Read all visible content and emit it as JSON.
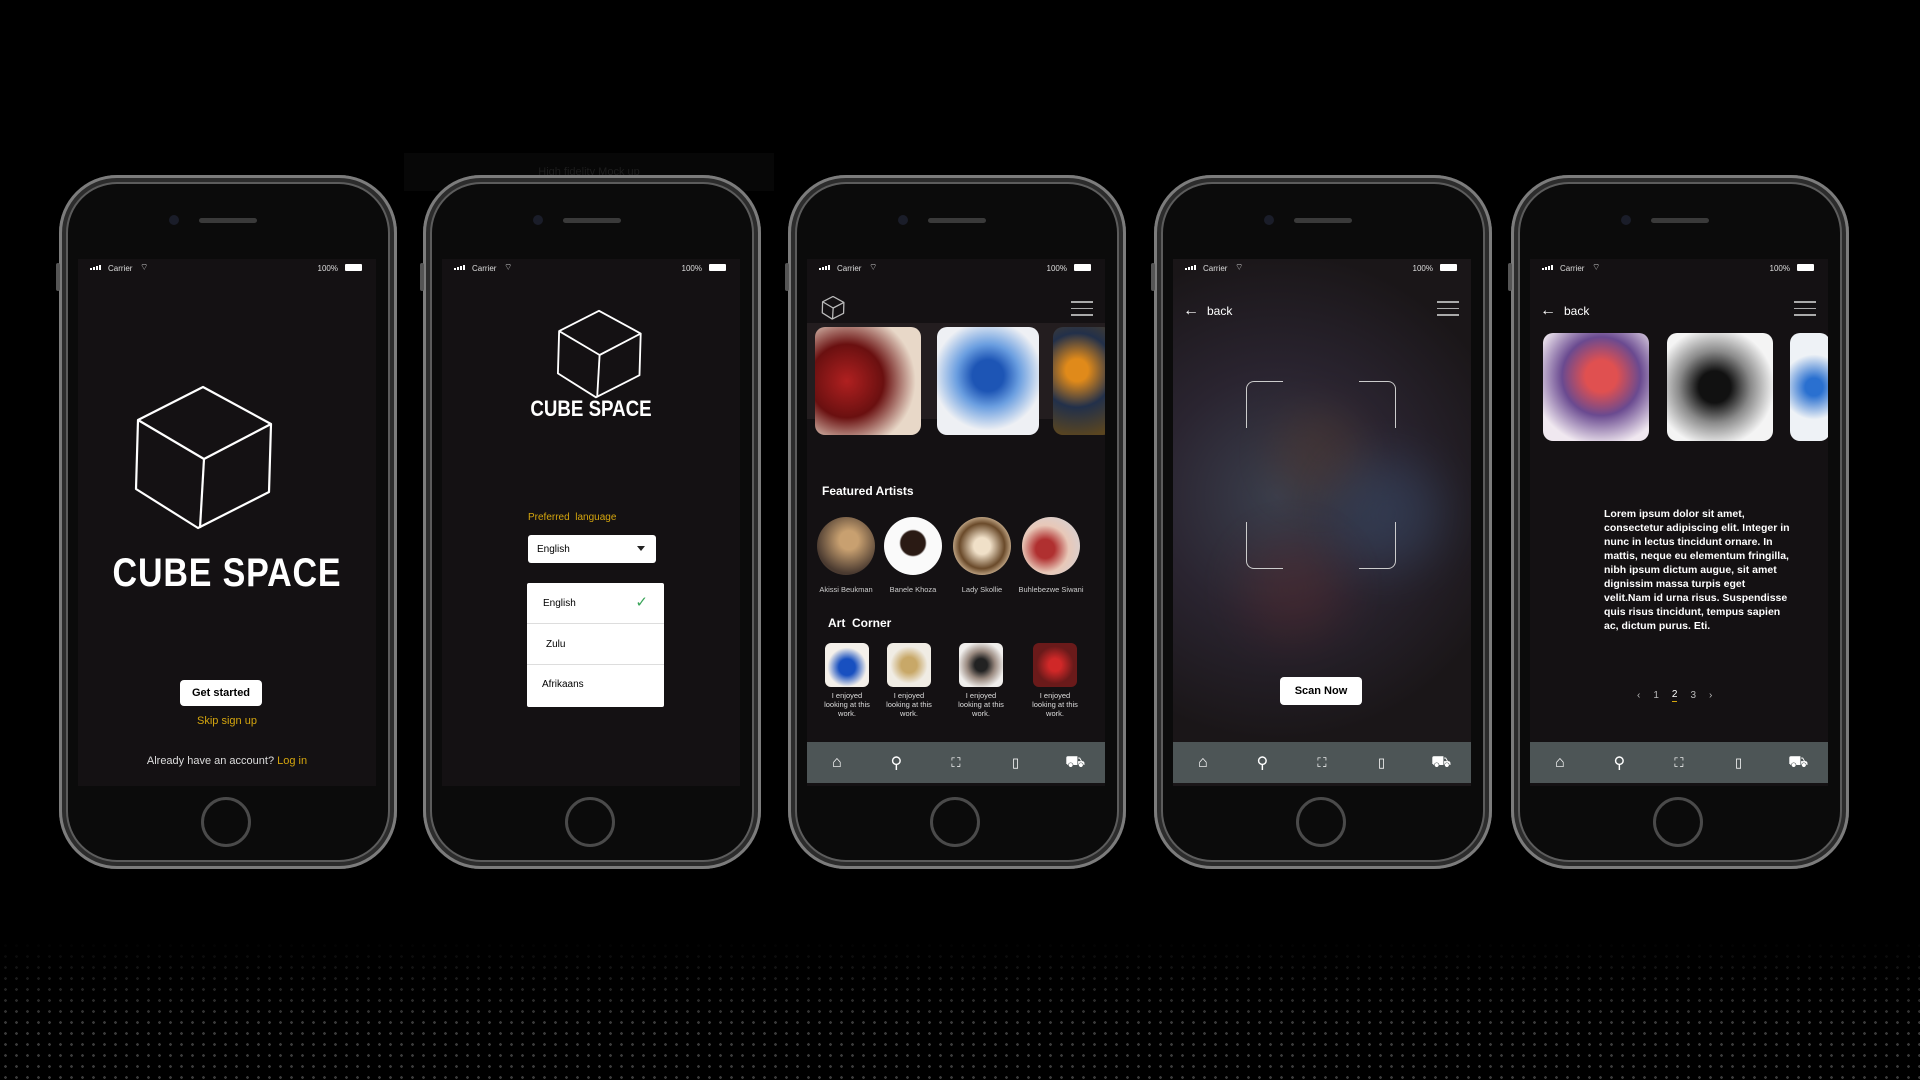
{
  "mockup_label": "High fidelity Mock up",
  "status_bar": {
    "carrier": "Carrier",
    "battery": "100%"
  },
  "colors": {
    "accent_gold": "#d4a50e",
    "screen_bg": "#141113",
    "tab_bar": "#4d5556",
    "check_green": "#3aa55a"
  },
  "welcome": {
    "brand": "CUBE SPACE",
    "get_started": "Get started",
    "skip": "Skip sign up",
    "already": "Already have an account?",
    "login": "Log in"
  },
  "language": {
    "brand": "CUBE SPACE",
    "label": "Preferred  language",
    "selected": "English",
    "options": [
      "English",
      "Zulu",
      "Afrikaans"
    ]
  },
  "home": {
    "featured_title": "Featured Artists",
    "artists": [
      "Akissi Beukman",
      "Banele Khoza",
      "Lady Skollie",
      "Buhlebezwe Siwani"
    ],
    "art_corner_title": "Art  Corner",
    "art_captions": [
      "I enjoyed looking at this work.",
      "I enjoyed looking at this work.",
      "I enjoyed looking at this work.",
      "I enjoyed looking at this work."
    ]
  },
  "scan": {
    "back": "back",
    "button": "Scan Now"
  },
  "detail": {
    "back": "back",
    "body": "Lorem ipsum dolor sit amet, consectetur adipiscing elit. Integer in nunc in lectus tincidunt ornare. In mattis, neque eu elementum fringilla, nibh ipsum dictum augue, sit amet dignissim massa turpis eget velit.Nam id urna risus. Suspendisse quis risus tincidunt, tempus sapien ac, dictum purus. Eti.",
    "pagination": {
      "prev": "‹",
      "pages": [
        "1",
        "2",
        "3"
      ],
      "current": "2",
      "next": "›"
    }
  },
  "tabbar_icons": [
    "home-icon",
    "search-icon",
    "scan-icon",
    "bookmark-icon",
    "cart-icon"
  ]
}
